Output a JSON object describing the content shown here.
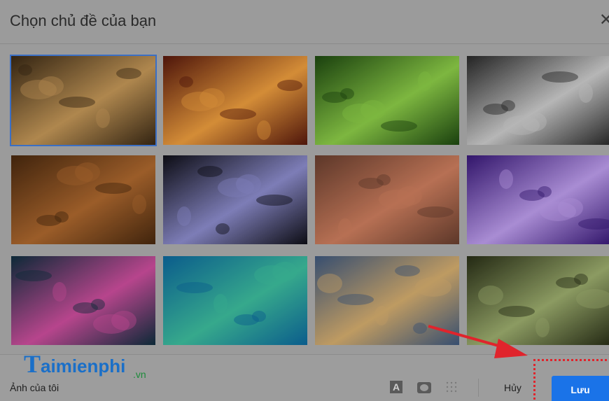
{
  "dialog": {
    "title": "Chọn chủ đề của bạn",
    "close_glyph": "✕"
  },
  "themes": [
    {
      "name": "chess",
      "colors": [
        "#3b2a16",
        "#c79a5a"
      ],
      "selected": true
    },
    {
      "name": "canyon-rock",
      "colors": [
        "#5a1a0e",
        "#f0a040"
      ],
      "selected": false
    },
    {
      "name": "caterpillar",
      "colors": [
        "#1f4a12",
        "#8fd04a"
      ],
      "selected": false
    },
    {
      "name": "pipes",
      "colors": [
        "#2a2a2a",
        "#cfcfcf"
      ],
      "selected": false
    },
    {
      "name": "autumn-leaves",
      "colors": [
        "#4a2a10",
        "#b06a30"
      ],
      "selected": false
    },
    {
      "name": "bokeh-lights",
      "colors": [
        "#101018",
        "#8f8fd0"
      ],
      "selected": false
    },
    {
      "name": "canyon-river",
      "colors": [
        "#6a4030",
        "#d08060"
      ],
      "selected": false
    },
    {
      "name": "jellyfish",
      "colors": [
        "#3a1a7a",
        "#c0a0f0"
      ],
      "selected": false
    },
    {
      "name": "rainbow-ripples",
      "colors": [
        "#103040",
        "#d050a0"
      ],
      "selected": false
    },
    {
      "name": "lake",
      "colors": [
        "#0e6aa0",
        "#3fc0a0"
      ],
      "selected": false
    },
    {
      "name": "beach",
      "colors": [
        "#405a80",
        "#d8b070"
      ],
      "selected": false
    },
    {
      "name": "forest",
      "colors": [
        "#2a3018",
        "#9fb070"
      ],
      "selected": false
    }
  ],
  "footer": {
    "my_photos": "Ảnh của tôi",
    "text_bg_icon": "A",
    "cancel": "Hủy",
    "save": "Lưu"
  },
  "watermark": {
    "brand_initial": "T",
    "brand_rest": "aimienphi",
    "brand_tld": ".vn"
  },
  "colors": {
    "accent": "#1a73e8",
    "arrow": "#e0242c"
  }
}
